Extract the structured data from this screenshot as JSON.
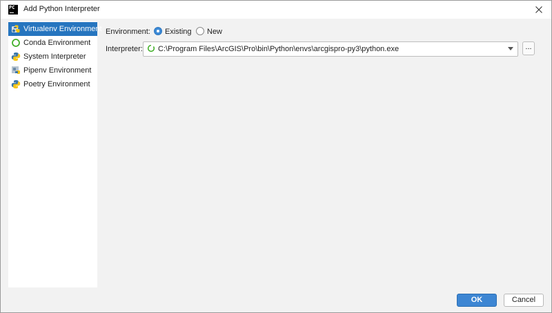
{
  "window": {
    "title": "Add Python Interpreter",
    "app_icon_text": "PC"
  },
  "sidebar": {
    "items": [
      {
        "label": "Virtualenv Environment",
        "icon": "python-venv-icon",
        "selected": true
      },
      {
        "label": "Conda Environment",
        "icon": "conda-icon",
        "selected": false
      },
      {
        "label": "System Interpreter",
        "icon": "python-icon",
        "selected": false
      },
      {
        "label": "Pipenv Environment",
        "icon": "pipenv-icon",
        "selected": false
      },
      {
        "label": "Poetry Environment",
        "icon": "poetry-icon",
        "selected": false
      }
    ]
  },
  "form": {
    "environment_label": "Environment:",
    "environment_options": [
      {
        "label": "Existing",
        "checked": true
      },
      {
        "label": "New",
        "checked": false
      }
    ],
    "interpreter_label": "Interpreter:",
    "interpreter_value": "C:\\Program Files\\ArcGIS\\Pro\\bin\\Python\\envs\\arcgispro-py3\\python.exe",
    "browse_label": "..."
  },
  "footer": {
    "ok_label": "OK",
    "cancel_label": "Cancel"
  },
  "colors": {
    "accent": "#2675bf",
    "ok_button": "#3d86d3",
    "conda_green": "#43b02a",
    "python_blue": "#3c78aa",
    "python_yellow": "#f5c518"
  }
}
